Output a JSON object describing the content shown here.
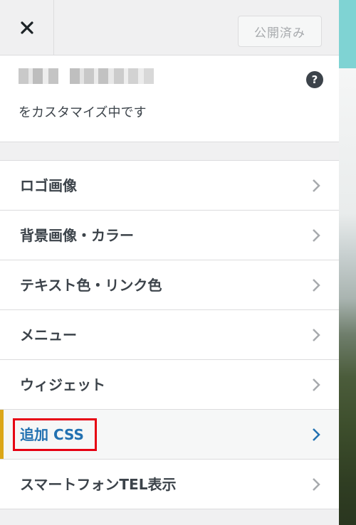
{
  "header": {
    "close_icon": "close-icon",
    "publish_label": "公開済み"
  },
  "info": {
    "customizing_text": "をカスタマイズ中です",
    "help_icon": "?"
  },
  "menu": {
    "items": [
      {
        "label": "ロゴ画像"
      },
      {
        "label": "背景画像・カラー"
      },
      {
        "label": "テキスト色・リンク色"
      },
      {
        "label": "メニュー"
      },
      {
        "label": "ウィジェット"
      },
      {
        "label": "追加 CSS"
      },
      {
        "label": "スマートフォンTEL表示"
      }
    ],
    "active_index": 5
  },
  "colors": {
    "accent_blue": "#2271b1",
    "active_bar": "#dba617",
    "highlight_red": "#e60012"
  }
}
